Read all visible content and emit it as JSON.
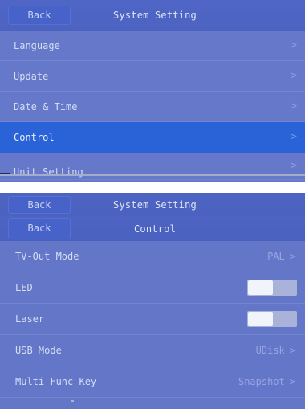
{
  "top_screen": {
    "back_label": "Back",
    "title": "System Setting",
    "menu": [
      {
        "label": "Language",
        "chevron": ">"
      },
      {
        "label": "Update",
        "chevron": ">"
      },
      {
        "label": "Date & Time",
        "chevron": ">"
      },
      {
        "label": "Control",
        "chevron": ">"
      },
      {
        "label": "Unit Setting",
        "chevron": ">"
      }
    ],
    "active_item": "Control"
  },
  "bottom_screen": {
    "parent_header": {
      "back_label": "Back",
      "title": "System Setting"
    },
    "header": {
      "back_label": "Back",
      "title": "Control"
    },
    "settings": {
      "tv_out": {
        "label": "TV-Out Mode",
        "value": "PAL",
        "chevron": ">"
      },
      "led": {
        "label": "LED",
        "state": "off"
      },
      "laser": {
        "label": "Laser",
        "state": "off"
      },
      "usb": {
        "label": "USB Mode",
        "value": "UDisk",
        "chevron": ">"
      },
      "multi_func": {
        "label": "Multi-Func Key",
        "value": "Snapshot",
        "chevron": ">"
      }
    }
  },
  "colors": {
    "header_bg": "#4f66c6",
    "panel_bg": "#6678c9",
    "active_row": "#2a63d8",
    "toggle_track": "#a9b3d9",
    "toggle_knob": "#f2f4fb"
  }
}
